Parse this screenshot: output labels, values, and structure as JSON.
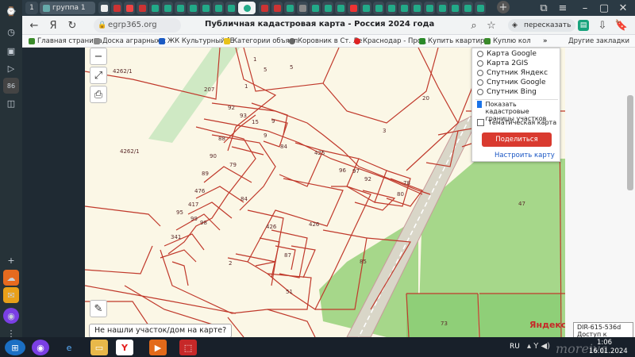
{
  "browser": {
    "tabs": [
      {
        "label": "1"
      },
      {
        "label": "группа 1"
      }
    ],
    "address": "egrp365.org",
    "page_title": "Публичная кадастровая карта - Россия 2024 года",
    "share_label": "пересказать",
    "bookmarks": [
      "Главная страница",
      "Доска аграрных с",
      "ЖК Культурный [Е",
      "Категории объявл",
      "Коровник в Ст. Ле",
      "Краснодар - Прод",
      "Купить квартиру",
      "Куплю кол"
    ],
    "other_bookmarks": "Другие закладки",
    "sidebar_badge": "86"
  },
  "map": {
    "layers": [
      {
        "label": "Карта Google",
        "type": "radio",
        "checked": false
      },
      {
        "label": "Карта 2GIS",
        "type": "radio",
        "checked": false
      },
      {
        "label": "Спутник Яндекс",
        "type": "radio",
        "checked": false
      },
      {
        "label": "Спутник Google",
        "type": "radio",
        "checked": false
      },
      {
        "label": "Спутник Bing",
        "type": "radio",
        "checked": false
      }
    ],
    "show_cadastral_label": "Показать кадастровые границы участков",
    "show_cadastral_checked": true,
    "thematic_label": "Тематическая карта",
    "thematic_checked": false,
    "share_button": "Поделиться ссылкой",
    "setup_link": "Настроить карту",
    "not_found": "Не нашли участок/дом на карте?",
    "cadnum_line1": "DIR-615-536d",
    "cadnum_line2": "Доступ к Интернету",
    "parcels": [
      "4262/1",
      "207",
      "4262/1",
      "1",
      "5",
      "5",
      "92",
      "93",
      "15",
      "9",
      "9",
      "84",
      "88",
      "79",
      "90",
      "89",
      "476",
      "417",
      "95",
      "99",
      "98",
      "341",
      "84",
      "425",
      "96",
      "97",
      "92",
      "78",
      "80",
      "3",
      "20",
      "47",
      "426",
      "426",
      "87",
      "2",
      "51",
      "85",
      "73",
      "1"
    ],
    "yandex": "Яндекс",
    "moreiva": "moreiva"
  },
  "taskbar": {
    "lang": "RU",
    "time": "1:06",
    "date": "16.01.2024"
  }
}
